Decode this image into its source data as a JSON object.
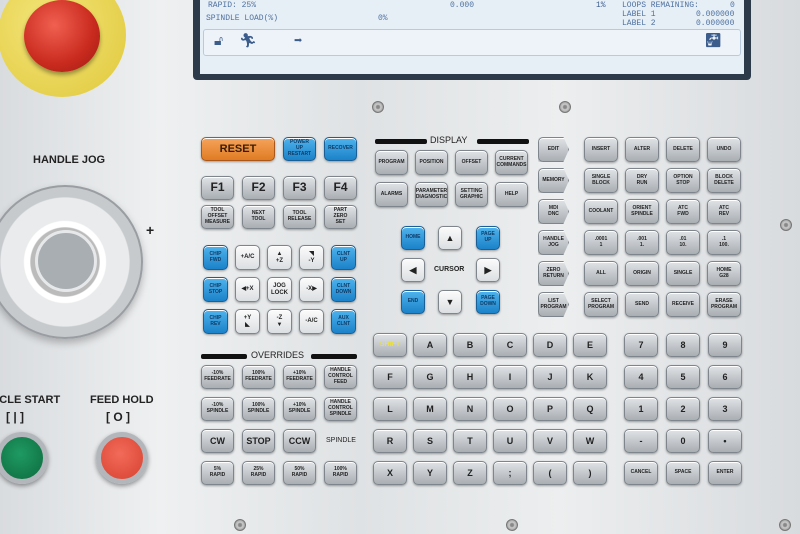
{
  "screen": {
    "rapid": "RAPID: 25%",
    "spindle_load": "SPINDLE LOAD(%)",
    "spindle_load_val": "0%",
    "pos_val": "0.000",
    "pos_pct": "1%",
    "loops": "LOOPS REMAINING:",
    "loops_val": "0",
    "label1": "LABEL 1",
    "label1_val": "0.000000",
    "label2": "LABEL 2",
    "label2_val": "0.000000",
    "icons": [
      "unlock-icon",
      "running-man-icon",
      "arrow-right-icon",
      "coolant-tap-icon"
    ]
  },
  "labels": {
    "handle_jog": "HANDLE JOG",
    "plus": "+",
    "cycle_start": "CYCLE START",
    "feed_hold": "FEED HOLD",
    "cycle_symbol": "[ | ]",
    "hold_symbol": "[ O ]",
    "display": "DISPLAY",
    "overrides": "OVERRIDES",
    "cursor": "CURSOR",
    "spindle": "SPINDLE"
  },
  "colors": {
    "estop": "#c92a1e",
    "cycle_start": "#0d7a48",
    "feed_hold": "#e0493a",
    "reset": "#e07c23",
    "blue_keys": "#1c82c9"
  },
  "keys": {
    "top": [
      {
        "t": "RESET",
        "c": "orange"
      },
      {
        "t": "POWER\nUP\nRESTART",
        "c": "blue"
      },
      {
        "t": "RECOVER",
        "c": "blue"
      }
    ],
    "fkeys": [
      {
        "t": "F1",
        "c": "big"
      },
      {
        "t": "F2",
        "c": "big"
      },
      {
        "t": "F3",
        "c": "big"
      },
      {
        "t": "F4",
        "c": "big"
      },
      {
        "t": "TOOL\nOFFSET\nMEASURE"
      },
      {
        "t": "NEXT\nTOOL"
      },
      {
        "t": "TOOL\nRELEASE"
      },
      {
        "t": "PART\nZERO\nSET"
      }
    ],
    "jog": [
      {
        "t": "CHIP\nFWD",
        "c": "blue"
      },
      {
        "t": "+A/C",
        "c": "white"
      },
      {
        "t": "▲\n+Z",
        "c": "white"
      },
      {
        "t": "◥\n-Y",
        "c": "white"
      },
      {
        "t": "CLNT\nUP",
        "c": "blue"
      },
      {
        "t": "CHIP\nSTOP",
        "c": "blue"
      },
      {
        "t": "◀+X",
        "c": "white"
      },
      {
        "t": "JOG\nLOCK",
        "c": "white"
      },
      {
        "t": "-X▶",
        "c": "white"
      },
      {
        "t": "CLNT\nDOWN",
        "c": "blue"
      },
      {
        "t": "CHIP\nREV",
        "c": "blue"
      },
      {
        "t": "+Y\n◣",
        "c": "white"
      },
      {
        "t": "-Z\n▼",
        "c": "white"
      },
      {
        "t": "-A/C",
        "c": "white"
      },
      {
        "t": "AUX\nCLNT",
        "c": "blue"
      }
    ],
    "display": [
      {
        "t": "PROGRAM"
      },
      {
        "t": "POSITION"
      },
      {
        "t": "OFFSET"
      },
      {
        "t": "CURRENT\nCOMMANDS"
      },
      {
        "t": "ALARMS"
      },
      {
        "t": "PARAMETER\nDIAGNOSTIC"
      },
      {
        "t": "SETTING\nGRAPHIC"
      },
      {
        "t": "HELP"
      }
    ],
    "cursor": {
      "home": "HOME",
      "up": "▲",
      "page_up": "PAGE\nUP",
      "left": "◀",
      "right": "▶",
      "end": "END",
      "down": "▼",
      "page_down": "PAGE\nDOWN"
    },
    "modes": [
      {
        "t": "EDIT"
      },
      {
        "t": "MEMORY"
      },
      {
        "t": "MDI\nDNC"
      },
      {
        "t": "HANDLE\nJOG"
      },
      {
        "t": "ZERO\nRETURN"
      },
      {
        "t": "LIST\nPROGRAM"
      }
    ],
    "edit": [
      {
        "t": "INSERT"
      },
      {
        "t": "ALTER"
      },
      {
        "t": "DELETE"
      },
      {
        "t": "UNDO"
      },
      {
        "t": "SINGLE\nBLOCK"
      },
      {
        "t": "DRY\nRUN"
      },
      {
        "t": "OPTION\nSTOP"
      },
      {
        "t": "BLOCK\nDELETE"
      },
      {
        "t": "COOLANT"
      },
      {
        "t": "ORIENT\nSPINDLE"
      },
      {
        "t": "ATC\nFWD"
      },
      {
        "t": "ATC\nREV"
      },
      {
        "t": ".0001\n1"
      },
      {
        "t": ".001\n1."
      },
      {
        "t": ".01\n10."
      },
      {
        "t": ".1\n100."
      },
      {
        "t": "ALL"
      },
      {
        "t": "ORIGIN"
      },
      {
        "t": "SINGLE"
      },
      {
        "t": "HOME\nG28"
      },
      {
        "t": "SELECT\nPROGRAM"
      },
      {
        "t": "SEND"
      },
      {
        "t": "RECEIVE"
      },
      {
        "t": "ERASE\nPROGRAM"
      }
    ],
    "overrides": [
      {
        "t": "-10%\nFEEDRATE"
      },
      {
        "t": "100%\nFEEDRATE"
      },
      {
        "t": "+10%\nFEEDRATE"
      },
      {
        "t": "HANDLE\nCONTROL\nFEED"
      },
      {
        "t": "-10%\nSPINDLE"
      },
      {
        "t": "100%\nSPINDLE"
      },
      {
        "t": "+10%\nSPINDLE"
      },
      {
        "t": "HANDLE\nCONTROL\nSPINDLE"
      },
      {
        "t": "CW",
        "c": "mid"
      },
      {
        "t": "STOP",
        "c": "mid"
      },
      {
        "t": "CCW",
        "c": "mid"
      },
      {
        "t": "5%\nRAPID"
      },
      {
        "t": "25%\nRAPID"
      },
      {
        "t": "50%\nRAPID"
      },
      {
        "t": "100%\nRAPID"
      }
    ],
    "alpha": [
      {
        "t": "SHIFT",
        "c": "shift"
      },
      {
        "t": "A",
        "c": "mid"
      },
      {
        "t": "B",
        "c": "mid"
      },
      {
        "t": "C",
        "c": "mid"
      },
      {
        "t": "D",
        "c": "mid"
      },
      {
        "t": "E",
        "c": "mid"
      },
      {
        "t": "F",
        "c": "mid"
      },
      {
        "t": "G",
        "c": "mid"
      },
      {
        "t": "H",
        "c": "mid"
      },
      {
        "t": "I",
        "c": "mid"
      },
      {
        "t": "J",
        "c": "mid"
      },
      {
        "t": "K",
        "c": "mid"
      },
      {
        "t": "L",
        "c": "mid"
      },
      {
        "t": "M",
        "c": "mid"
      },
      {
        "t": "N",
        "c": "mid"
      },
      {
        "t": "O",
        "c": "mid"
      },
      {
        "t": "P",
        "c": "mid"
      },
      {
        "t": "Q",
        "c": "mid"
      },
      {
        "t": "R",
        "c": "mid"
      },
      {
        "t": "S",
        "c": "mid"
      },
      {
        "t": "T",
        "c": "mid"
      },
      {
        "t": "U",
        "c": "mid"
      },
      {
        "t": "V",
        "c": "mid"
      },
      {
        "t": "W",
        "c": "mid"
      },
      {
        "t": "X",
        "c": "mid"
      },
      {
        "t": "Y",
        "c": "mid"
      },
      {
        "t": "Z",
        "c": "mid"
      },
      {
        "t": ";",
        "c": "mid"
      },
      {
        "t": "(",
        "c": "mid"
      },
      {
        "t": ")",
        "c": "mid"
      }
    ],
    "numeric": [
      {
        "t": "7",
        "c": "mid"
      },
      {
        "t": "8",
        "c": "mid"
      },
      {
        "t": "9",
        "c": "mid"
      },
      {
        "t": "4",
        "c": "mid"
      },
      {
        "t": "5",
        "c": "mid"
      },
      {
        "t": "6",
        "c": "mid"
      },
      {
        "t": "1",
        "c": "mid"
      },
      {
        "t": "2",
        "c": "mid"
      },
      {
        "t": "3",
        "c": "mid"
      },
      {
        "t": "-",
        "c": "mid"
      },
      {
        "t": "0",
        "c": "mid"
      },
      {
        "t": "•",
        "c": "mid"
      },
      {
        "t": "CANCEL"
      },
      {
        "t": "SPACE"
      },
      {
        "t": "ENTER"
      }
    ]
  }
}
